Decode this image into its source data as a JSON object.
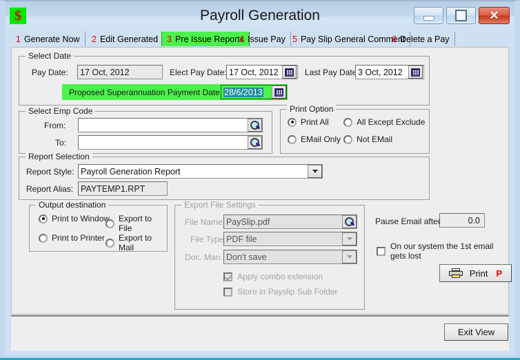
{
  "window": {
    "title": "Payroll Generation",
    "icon": "dollar-icon",
    "minimize_label": "Minimize",
    "maximize_label": "Maximize",
    "close_label": "Close"
  },
  "tabs": [
    {
      "num": "1",
      "label": "Generate Now",
      "active": false
    },
    {
      "num": "2",
      "label": "Edit Generated",
      "active": false
    },
    {
      "num": "3",
      "label": "Pre Issue Reports",
      "active": true
    },
    {
      "num": "4",
      "label": "Issue Pay",
      "active": false
    },
    {
      "num": "5",
      "label": "Pay Slip General Comment",
      "active": false
    },
    {
      "num": "6",
      "label": "Delete a Pay",
      "active": false
    }
  ],
  "select_date": {
    "legend": "Select Date",
    "pay_date_label": "Pay Date:",
    "pay_date_value": "17 Oct, 2012",
    "elect_pay_date_label": "Elect Pay Date:",
    "elect_pay_date_value": "17 Oct, 2012",
    "last_pay_date_label": "Last Pay Date:",
    "last_pay_date_value": "3 Oct, 2012",
    "super_label": "Proposed Superannuation Payment Date:",
    "super_value": "28/6/2013"
  },
  "select_emp_code": {
    "legend": "Select Emp Code",
    "from_label": "From:",
    "from_value": "",
    "to_label": "To:",
    "to_value": ""
  },
  "print_option": {
    "legend": "Print Option",
    "options": [
      {
        "label": "Print All",
        "selected": true
      },
      {
        "label": "All Except Exclude",
        "selected": false
      },
      {
        "label": "EMail Only",
        "selected": false
      },
      {
        "label": "Not EMail",
        "selected": false
      }
    ]
  },
  "report_selection": {
    "legend": "Report Selection",
    "style_label": "Report Style:",
    "style_value": "Payroll Generation Report",
    "alias_label": "Report Alias:",
    "alias_value": "PAYTEMP1.RPT"
  },
  "output_destination": {
    "legend": "Output destination",
    "options": [
      {
        "label": "Print to Window",
        "selected": true
      },
      {
        "label": "Export to File",
        "selected": false
      },
      {
        "label": "Print to Printer",
        "selected": false
      },
      {
        "label": "Export to Mail",
        "selected": false
      }
    ]
  },
  "export_file_settings": {
    "legend": "Export  File Settings",
    "file_name_label": "File Name:",
    "file_name_value": "PaySlip.pdf",
    "file_type_label": "File Type:",
    "file_type_value": "PDF file",
    "doc_man_label": "Doc. Man.",
    "doc_man_value": "Don't save",
    "apply_combo_label": "Apply combo extension",
    "apply_combo_checked": true,
    "store_sub_label": "Store in  Payslip Sub Folder",
    "store_sub_checked": false
  },
  "email_panel": {
    "pause_label": "Pause Email after:",
    "pause_value": "0.0",
    "first_email_label": "On our system the 1st email gets lost",
    "first_email_checked": false,
    "print_button": "Print",
    "print_accel": "P"
  },
  "footer": {
    "exit_label": "Exit View"
  },
  "colors": {
    "active_tab": "#4cf24c",
    "tab_number": "#e00000",
    "selection": "#1e8f9e",
    "accent_bottom": "#2aa8bc"
  }
}
